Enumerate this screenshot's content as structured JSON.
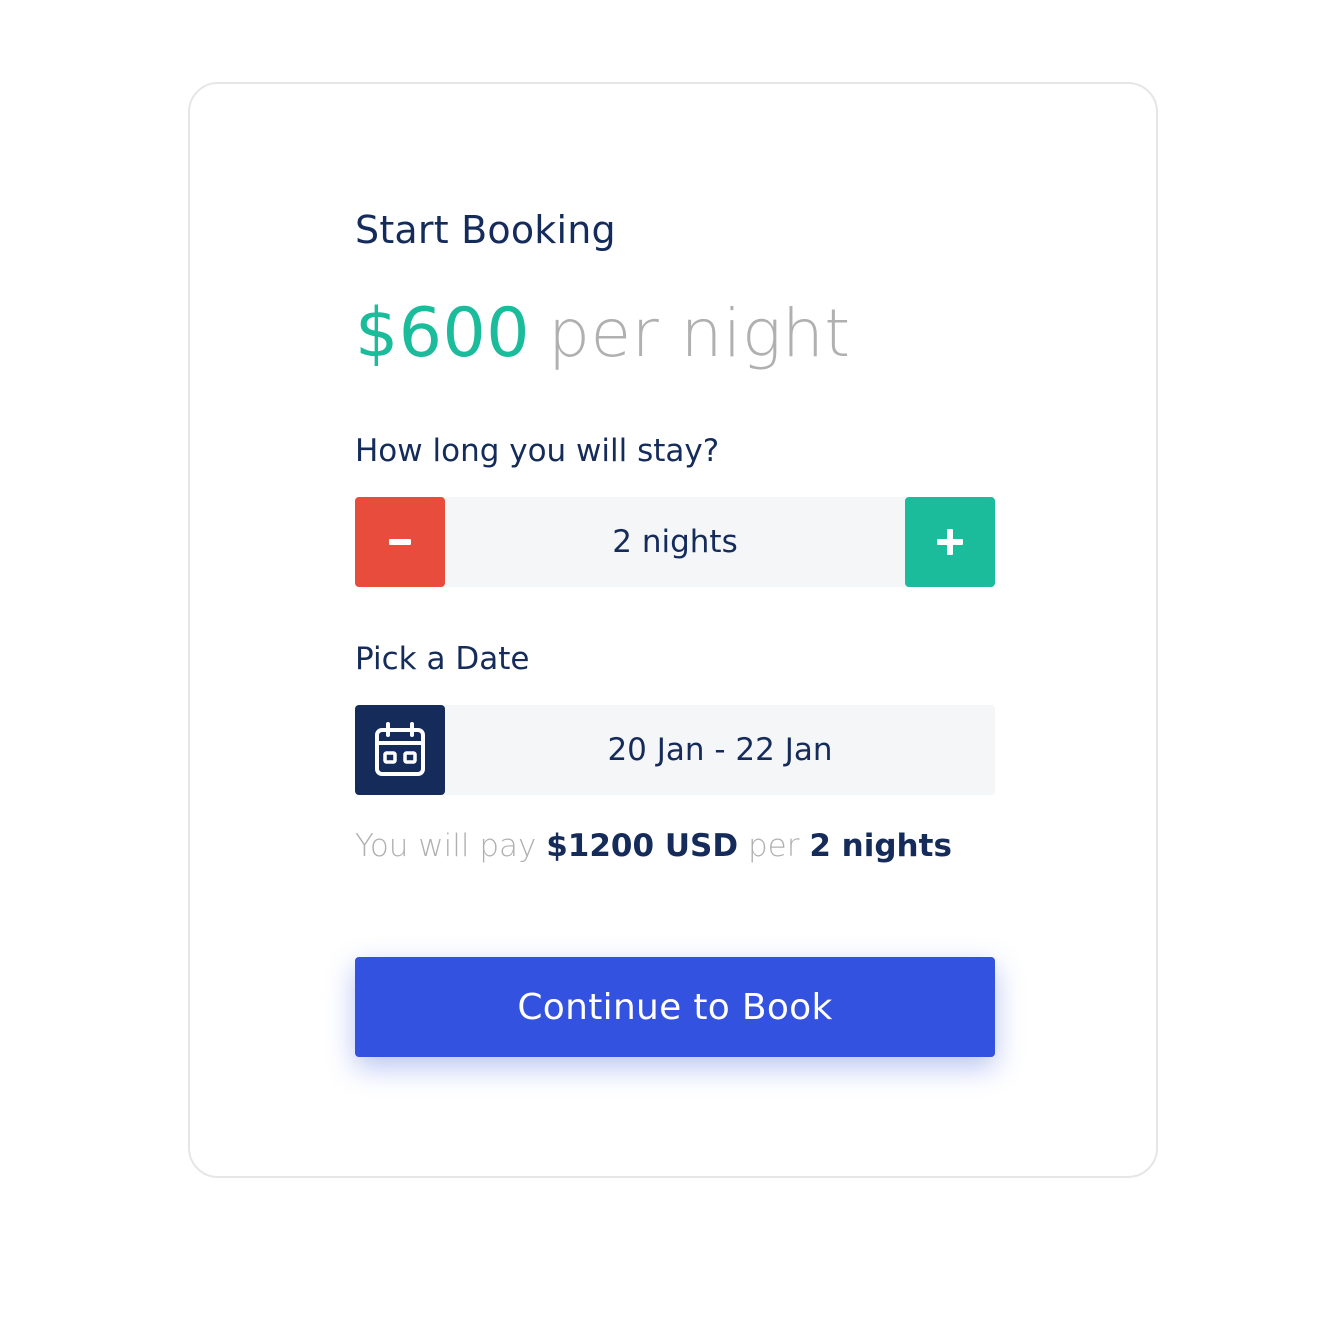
{
  "booking": {
    "title": "Start Booking",
    "price": {
      "amount": "$600",
      "unit": "per night"
    },
    "duration": {
      "label": "How long you will stay?",
      "value": "2 nights",
      "decrement_icon": "minus-icon",
      "increment_icon": "plus-icon"
    },
    "date": {
      "label": "Pick a Date",
      "value": "20 Jan - 22 Jan",
      "icon": "calendar-icon"
    },
    "summary": {
      "prefix": "You will pay",
      "total": "$1200 USD",
      "middle": "per",
      "nights": "2 nights"
    },
    "cta_label": "Continue to Book"
  },
  "colors": {
    "primary_text": "#152c5b",
    "accent_green": "#1abc9c",
    "accent_red": "#e74c3c",
    "primary_button": "#3252df",
    "muted_text": "#b0b0b0",
    "field_bg": "#f5f6f8"
  }
}
